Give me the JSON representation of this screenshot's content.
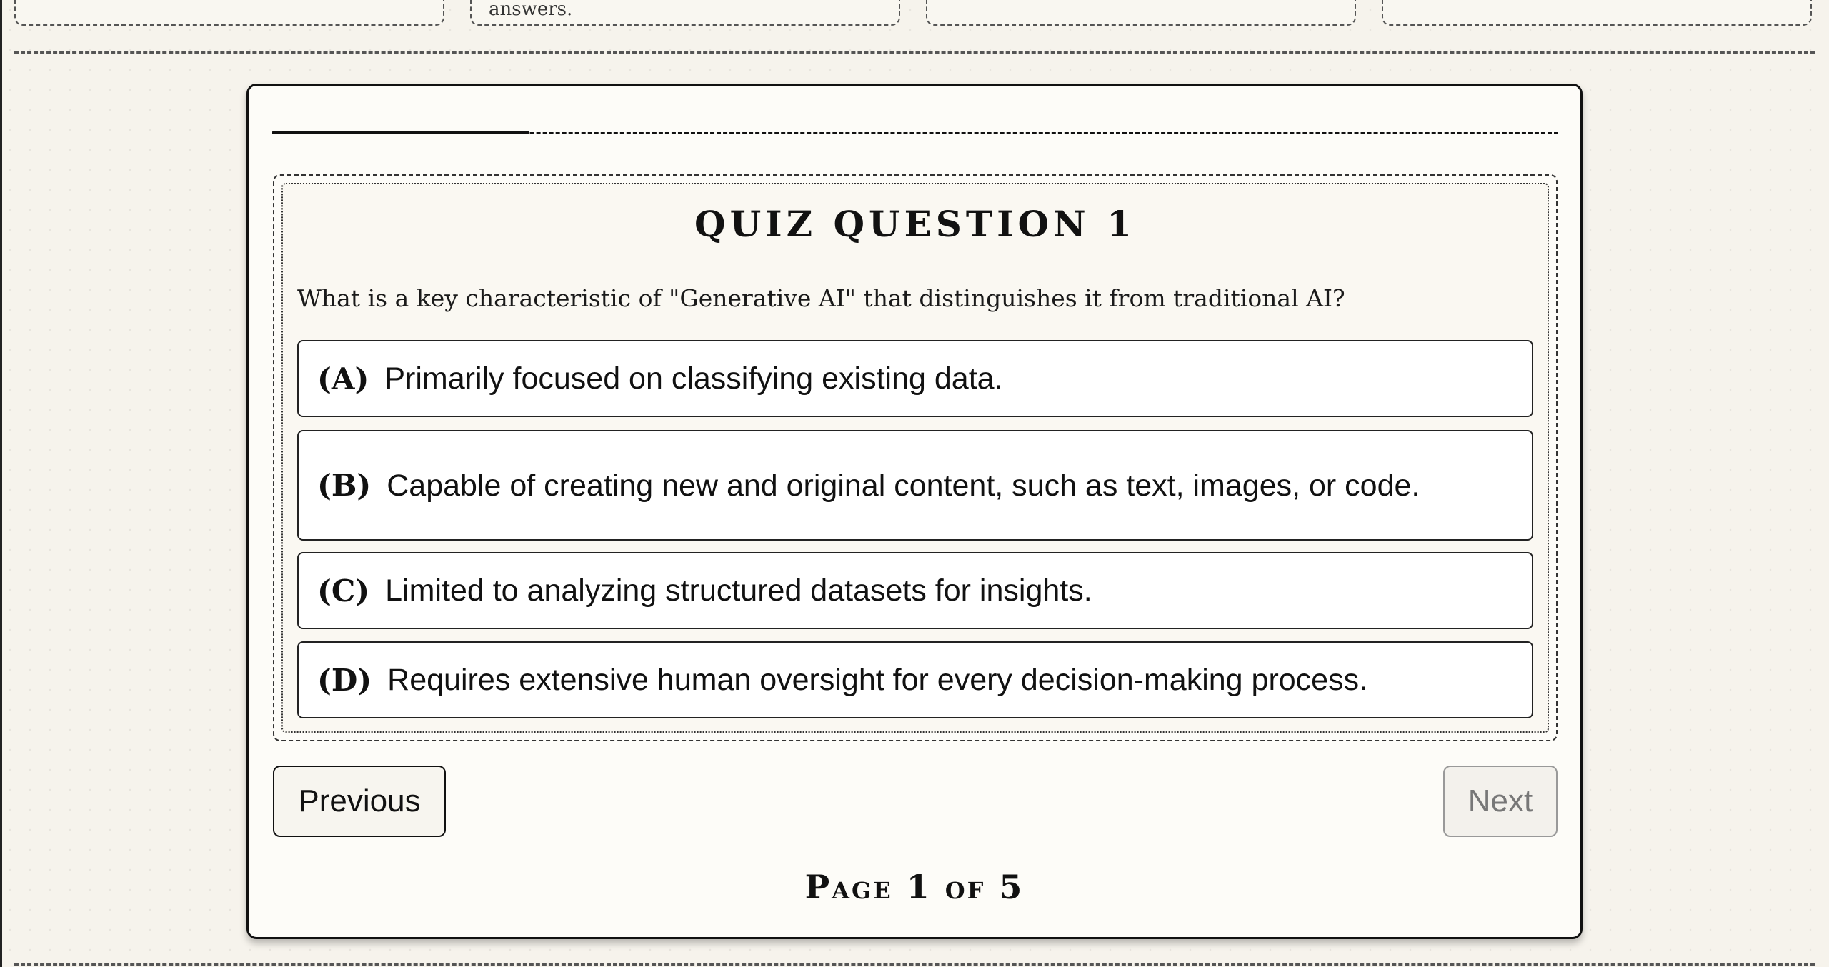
{
  "top_cards": [
    {
      "snippet": ""
    },
    {
      "snippet": "answers."
    },
    {
      "snippet": ""
    },
    {
      "snippet": ""
    }
  ],
  "quiz": {
    "progress_fraction": 0.2,
    "title": "Quiz Question 1",
    "question": "What is a key characteristic of \"Generative AI\" that distinguishes it from traditional AI?",
    "options": [
      {
        "letter": "(A)",
        "text": "Primarily focused on classifying existing data."
      },
      {
        "letter": "(B)",
        "text": "Capable of creating new and original content, such as text, images, or code."
      },
      {
        "letter": "(C)",
        "text": "Limited to analyzing structured datasets for insights."
      },
      {
        "letter": "(D)",
        "text": "Requires extensive human oversight for every decision-making process."
      }
    ]
  },
  "navigation": {
    "previous_label": "Previous",
    "next_label": "Next",
    "page_indicator": "Page 1 of 5"
  }
}
